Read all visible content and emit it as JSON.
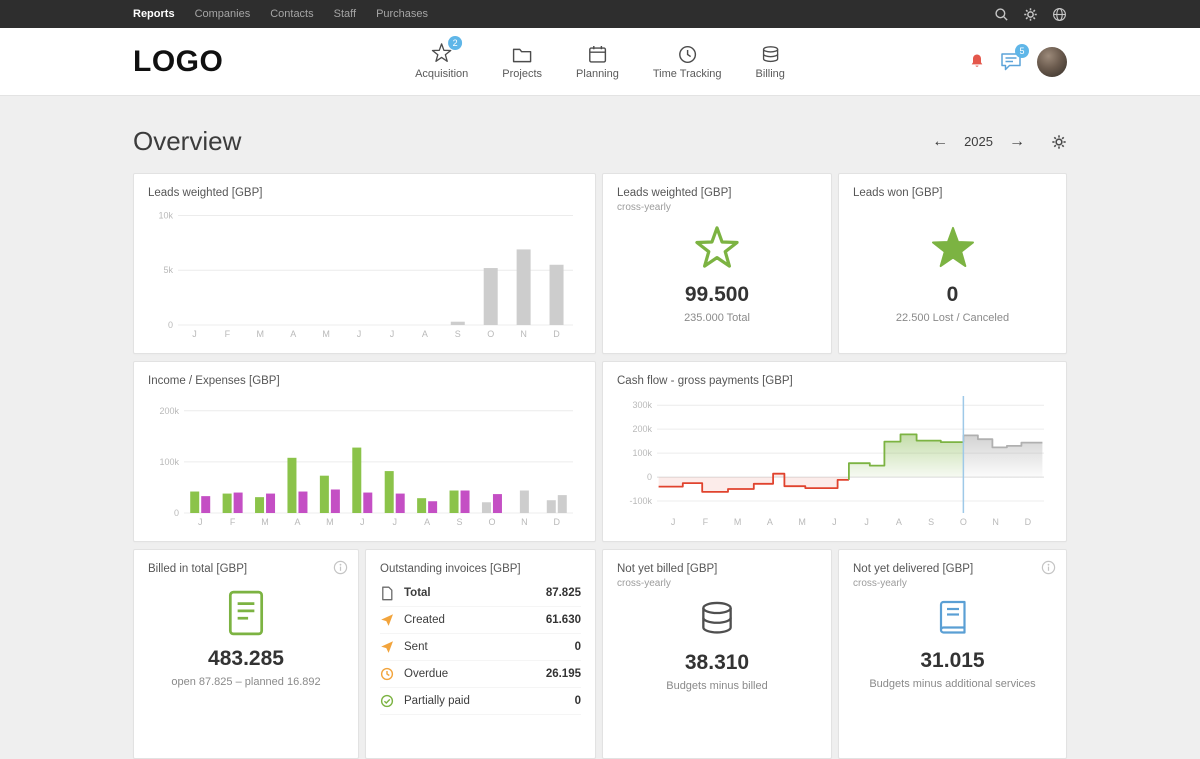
{
  "topbar": {
    "items": [
      {
        "label": "Reports",
        "active": true
      },
      {
        "label": "Companies"
      },
      {
        "label": "Contacts"
      },
      {
        "label": "Staff"
      },
      {
        "label": "Purchases"
      }
    ],
    "icons": [
      "search-icon",
      "gear-icon",
      "globe-icon"
    ]
  },
  "header": {
    "logo": "LOGO",
    "nav": [
      {
        "label": "Acquisition",
        "icon": "star-icon",
        "badge": "2"
      },
      {
        "label": "Projects",
        "icon": "folder-icon"
      },
      {
        "label": "Planning",
        "icon": "calendar-icon"
      },
      {
        "label": "Time Tracking",
        "icon": "clock-icon"
      },
      {
        "label": "Billing",
        "icon": "billing-stack-icon"
      }
    ],
    "notifications": {
      "bell_icon": "bell-icon",
      "chat_icon": "chat-icon",
      "chat_badge": "5"
    }
  },
  "page": {
    "title": "Overview",
    "year": "2025",
    "prev_arrow": "←",
    "next_arrow": "→"
  },
  "cards": {
    "leads_weighted_chart": {
      "title": "Leads weighted [GBP]"
    },
    "leads_weighted_summary": {
      "title": "Leads weighted [GBP]",
      "subtitle": "cross-yearly",
      "icon": "star-outline-icon",
      "value": "99.500",
      "sub": "235.000 Total"
    },
    "leads_won": {
      "title": "Leads won [GBP]",
      "icon": "star-filled-icon",
      "value": "0",
      "sub": "22.500 Lost / Canceled"
    },
    "income_expenses": {
      "title": "Income / Expenses [GBP]"
    },
    "cashflow": {
      "title": "Cash flow - gross payments [GBP]"
    },
    "billed_total": {
      "title": "Billed in total [GBP]",
      "icon": "document-icon",
      "value": "483.285",
      "sub": "open 87.825 – planned 16.892"
    },
    "outstanding": {
      "title": "Outstanding invoices [GBP]",
      "rows": [
        {
          "icon": "document-icon",
          "label": "Total",
          "value": "87.825",
          "bold": true
        },
        {
          "icon": "send-icon",
          "label": "Created",
          "value": "61.630"
        },
        {
          "icon": "send-icon",
          "label": "Sent",
          "value": "0"
        },
        {
          "icon": "overdue-clock-icon",
          "label": "Overdue",
          "value": "26.195"
        },
        {
          "icon": "check-circle-icon",
          "label": "Partially paid",
          "value": "0"
        }
      ]
    },
    "not_yet_billed": {
      "title": "Not yet billed [GBP]",
      "subtitle": "cross-yearly",
      "icon": "coins-stack-icon",
      "value": "38.310",
      "sub": "Budgets minus billed"
    },
    "not_yet_delivered": {
      "title": "Not yet delivered [GBP]",
      "subtitle": "cross-yearly",
      "icon": "book-icon",
      "value": "31.015",
      "sub": "Budgets minus additional services"
    }
  },
  "chart_data": [
    {
      "id": "leads_monthly",
      "type": "bar",
      "title": "Leads weighted [GBP]",
      "categories": [
        "J",
        "F",
        "M",
        "A",
        "M",
        "J",
        "J",
        "A",
        "S",
        "O",
        "N",
        "D"
      ],
      "values": [
        0,
        0,
        0,
        0,
        0,
        0,
        0,
        0,
        300,
        5200,
        6900,
        5500
      ],
      "color": "#cdcdcd",
      "ylim": [
        0,
        10500
      ],
      "yticks": [
        {
          "value": 0,
          "label": "0"
        },
        {
          "value": 5000,
          "label": "5k"
        },
        {
          "value": 10000,
          "label": "10k"
        }
      ],
      "pad_left": 30
    },
    {
      "id": "income_expenses",
      "type": "grouped-bar",
      "title": "Income / Expenses [GBP]",
      "categories": [
        "J",
        "F",
        "M",
        "A",
        "M",
        "J",
        "J",
        "A",
        "S",
        "O",
        "N",
        "D"
      ],
      "palette": {
        "income": "#8bc34a",
        "expenses": "#c44fc4",
        "planned": "#cdcdcd"
      },
      "months": [
        [
          {
            "series": "income",
            "value": 42000
          },
          {
            "series": "expenses",
            "value": 33000
          }
        ],
        [
          {
            "series": "income",
            "value": 38000
          },
          {
            "series": "expenses",
            "value": 40000
          }
        ],
        [
          {
            "series": "income",
            "value": 31000
          },
          {
            "series": "expenses",
            "value": 38000
          }
        ],
        [
          {
            "series": "income",
            "value": 108000
          },
          {
            "series": "expenses",
            "value": 42000
          }
        ],
        [
          {
            "series": "income",
            "value": 73000
          },
          {
            "series": "expenses",
            "value": 46000
          }
        ],
        [
          {
            "series": "income",
            "value": 128000
          },
          {
            "series": "expenses",
            "value": 40000
          }
        ],
        [
          {
            "series": "income",
            "value": 82000
          },
          {
            "series": "expenses",
            "value": 38000
          }
        ],
        [
          {
            "series": "income",
            "value": 29000
          },
          {
            "series": "expenses",
            "value": 23000
          }
        ],
        [
          {
            "series": "income",
            "value": 44000
          },
          {
            "series": "expenses",
            "value": 44000
          }
        ],
        [
          {
            "series": "planned",
            "value": 21000
          },
          {
            "series": "expenses",
            "value": 37000
          }
        ],
        [
          {
            "series": "planned",
            "value": 44000
          }
        ],
        [
          {
            "series": "planned",
            "value": 25000
          },
          {
            "series": "planned",
            "value": 35000
          }
        ]
      ],
      "ylim": [
        0,
        225000
      ],
      "yticks": [
        {
          "value": 0,
          "label": "0"
        },
        {
          "value": 100000,
          "label": "100k"
        },
        {
          "value": 200000,
          "label": "200k"
        }
      ],
      "pad_left": 36
    },
    {
      "id": "cashflow",
      "type": "step-area",
      "title": "Cash flow - gross payments [GBP]",
      "categories": [
        "J",
        "F",
        "M",
        "A",
        "M",
        "J",
        "J",
        "A",
        "S",
        "O",
        "N",
        "D"
      ],
      "ylim": [
        -150000,
        330000
      ],
      "yticks": [
        {
          "value": -100000,
          "label": "-100k"
        },
        {
          "value": 0,
          "label": "0"
        },
        {
          "value": 100000,
          "label": "100k"
        },
        {
          "value": 200000,
          "label": "200k"
        },
        {
          "value": 300000,
          "label": "300k"
        }
      ],
      "today_x": 9.0,
      "segments": [
        {
          "name": "actual-negative",
          "color": "#e0432e",
          "fill": "rgba(224,67,46,0.10)",
          "points": [
            [
              -0.45,
              -40000
            ],
            [
              0.3,
              -40000
            ],
            [
              0.3,
              -25000
            ],
            [
              0.9,
              -25000
            ],
            [
              0.9,
              -62000
            ],
            [
              1.7,
              -62000
            ],
            [
              1.7,
              -50000
            ],
            [
              2.5,
              -50000
            ],
            [
              2.5,
              -28000
            ],
            [
              3.1,
              -28000
            ],
            [
              3.1,
              14000
            ],
            [
              3.45,
              14000
            ],
            [
              3.45,
              -38000
            ],
            [
              4.1,
              -38000
            ],
            [
              4.1,
              -46000
            ],
            [
              5.1,
              -46000
            ],
            [
              5.1,
              -12000
            ],
            [
              5.45,
              -12000
            ]
          ]
        },
        {
          "name": "actual-positive",
          "color": "#7cb342",
          "fill": "url(#gradGreen)",
          "points": [
            [
              5.45,
              -12000
            ],
            [
              5.45,
              58000
            ],
            [
              6.1,
              58000
            ],
            [
              6.1,
              48000
            ],
            [
              6.55,
              48000
            ],
            [
              6.55,
              148000
            ],
            [
              7.05,
              148000
            ],
            [
              7.05,
              178000
            ],
            [
              7.55,
              178000
            ],
            [
              7.55,
              152000
            ],
            [
              8.3,
              152000
            ],
            [
              8.3,
              146000
            ],
            [
              9.0,
              146000
            ]
          ]
        },
        {
          "name": "forecast",
          "color": "#b0b0b0",
          "fill": "url(#gradGray)",
          "points": [
            [
              9.0,
              146000
            ],
            [
              9.0,
              174000
            ],
            [
              9.45,
              174000
            ],
            [
              9.45,
              158000
            ],
            [
              9.9,
              158000
            ],
            [
              9.9,
              124000
            ],
            [
              10.35,
              124000
            ],
            [
              10.35,
              130000
            ],
            [
              10.8,
              130000
            ],
            [
              10.8,
              144000
            ],
            [
              11.45,
              144000
            ]
          ]
        }
      ],
      "pad_left": 40
    }
  ],
  "colors": {
    "green": "#7cb342",
    "magenta": "#c44fc4",
    "blue": "#5fb6e8",
    "orange": "#f2a43c",
    "bell_red": "#e4574b",
    "bar_gray": "#cdcdcd"
  }
}
